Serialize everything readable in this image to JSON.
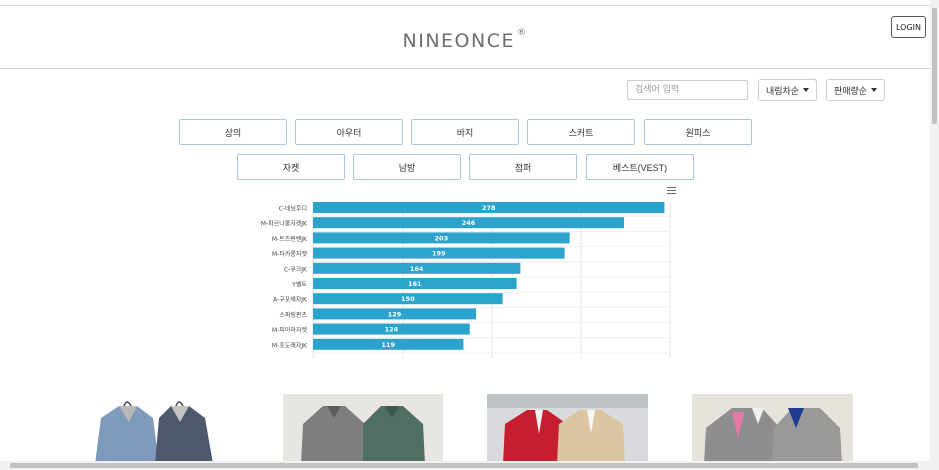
{
  "header": {
    "logo_text": "NINEONCE",
    "logo_mark": "®",
    "login_label": "LOGIN"
  },
  "toolbar": {
    "search_placeholder": "검색어 입력",
    "sort_order_label": "내림차순",
    "sort_field_label": "판매량순"
  },
  "categories": {
    "row1": [
      "상의",
      "아우터",
      "바지",
      "스커트",
      "원피스"
    ],
    "row2": [
      "자켓",
      "남방",
      "점퍼",
      "베스트(VEST)"
    ]
  },
  "chart_data": {
    "type": "bar",
    "orientation": "horizontal",
    "categories": [
      "C-데님후디",
      "M-파르나울자켓JK",
      "M-트즈핀밴JK",
      "M-타카롱자켓",
      "C-쿠크JK",
      "Y벨트",
      "A-구포헤자JK",
      "스퍼링판츠",
      "M-피아마자켓",
      "M-포도래자JK"
    ],
    "values": [
      278,
      246,
      203,
      199,
      164,
      161,
      150,
      129,
      124,
      119
    ],
    "xlim": [
      0,
      280
    ],
    "title": "",
    "xlabel": "",
    "ylabel": "",
    "bar_color": "#2ca3cc",
    "grid": true
  },
  "colors": {
    "accent": "#2ca3cc",
    "button_border": "#a9c6dd"
  },
  "icons": {
    "chart_menu": "hamburger-menu-icon"
  }
}
